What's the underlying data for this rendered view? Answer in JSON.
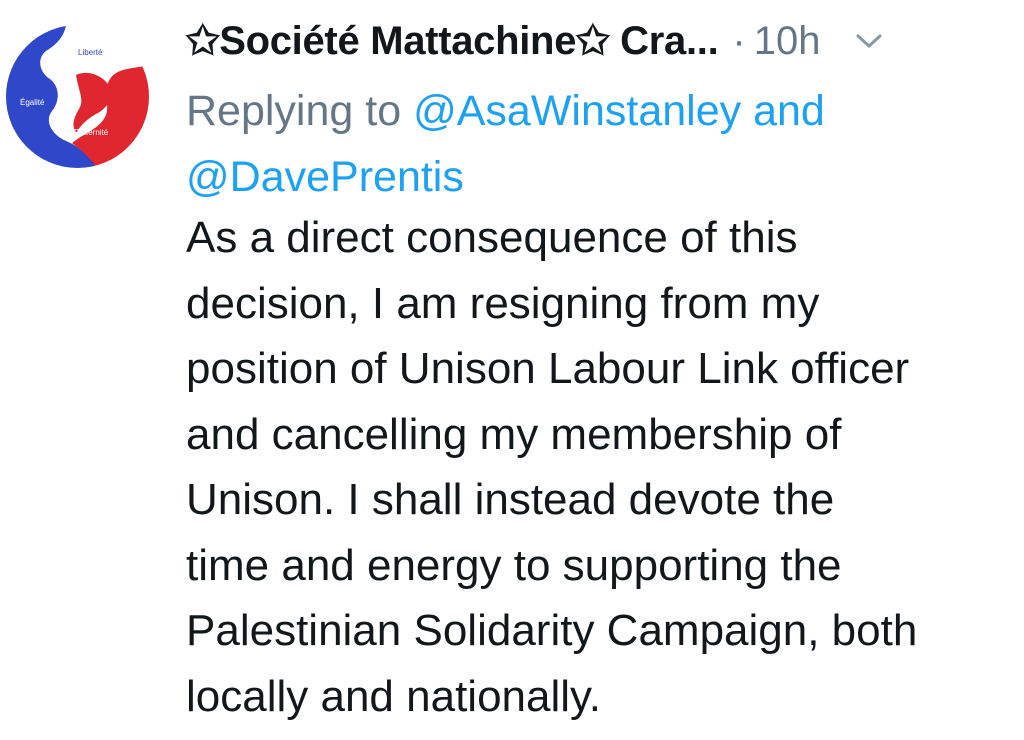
{
  "tweet": {
    "author_name": "✩Société Mattachine✩ Cra...",
    "separator": "·",
    "timestamp": "10h",
    "avatar_icon": "tricolor-puzzle-logo",
    "avatar_text": {
      "liberte": "Liberté",
      "egalite": "Égalité",
      "fraternite": "Fraternité"
    },
    "avatar_colors": {
      "blue": "#2f47c9",
      "red": "#e0262f",
      "white": "#ffffff"
    },
    "menu_icon": "chevron-down-icon",
    "replying_to_label": "Replying to",
    "mention_1": "@AsaWinstanley",
    "conjunction": "and",
    "mention_2": "@DavePrentis",
    "mention_color": "#1da1f2",
    "body_lines": [
      "As a direct consequence of this",
      "decision, I am resigning from my",
      "position of Unison Labour Link officer",
      "and cancelling my membership of",
      "Unison. I shall instead devote the",
      "time and energy to supporting the",
      "Palestinian Solidarity Campaign, both",
      "locally and nationally."
    ]
  }
}
